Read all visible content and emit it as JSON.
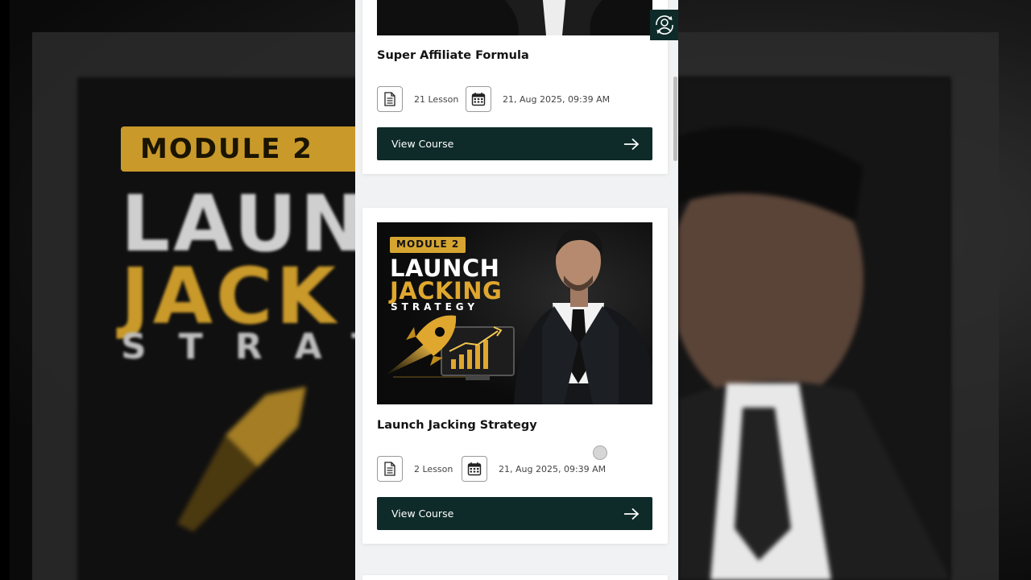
{
  "background": {
    "module_label": "MODULE 2",
    "line1": "LAUN",
    "line2": "JACK",
    "line3": "STRAT"
  },
  "courses": [
    {
      "title": "Super Affiliate Formula",
      "lessons": "21 Lesson",
      "date": "21, Aug 2025, 09:39 AM",
      "button": "View Course"
    },
    {
      "title": "Launch Jacking Strategy",
      "lessons": "2 Lesson",
      "date": "21, Aug 2025, 09:39 AM",
      "button": "View Course",
      "thumbnail": {
        "module_label": "MODULE 2",
        "line1": "LAUNCH",
        "line2": "JACKING",
        "line3": "STRATEGY"
      }
    }
  ],
  "icons": {
    "lessons": "document-icon",
    "date": "calendar-icon",
    "button": "arrow-right-icon",
    "floating": "user-sync-icon"
  },
  "colors": {
    "button_bg": "#0e2b29",
    "accent_gold": "#e0a72e",
    "page_bg": "#f1f2f3"
  }
}
